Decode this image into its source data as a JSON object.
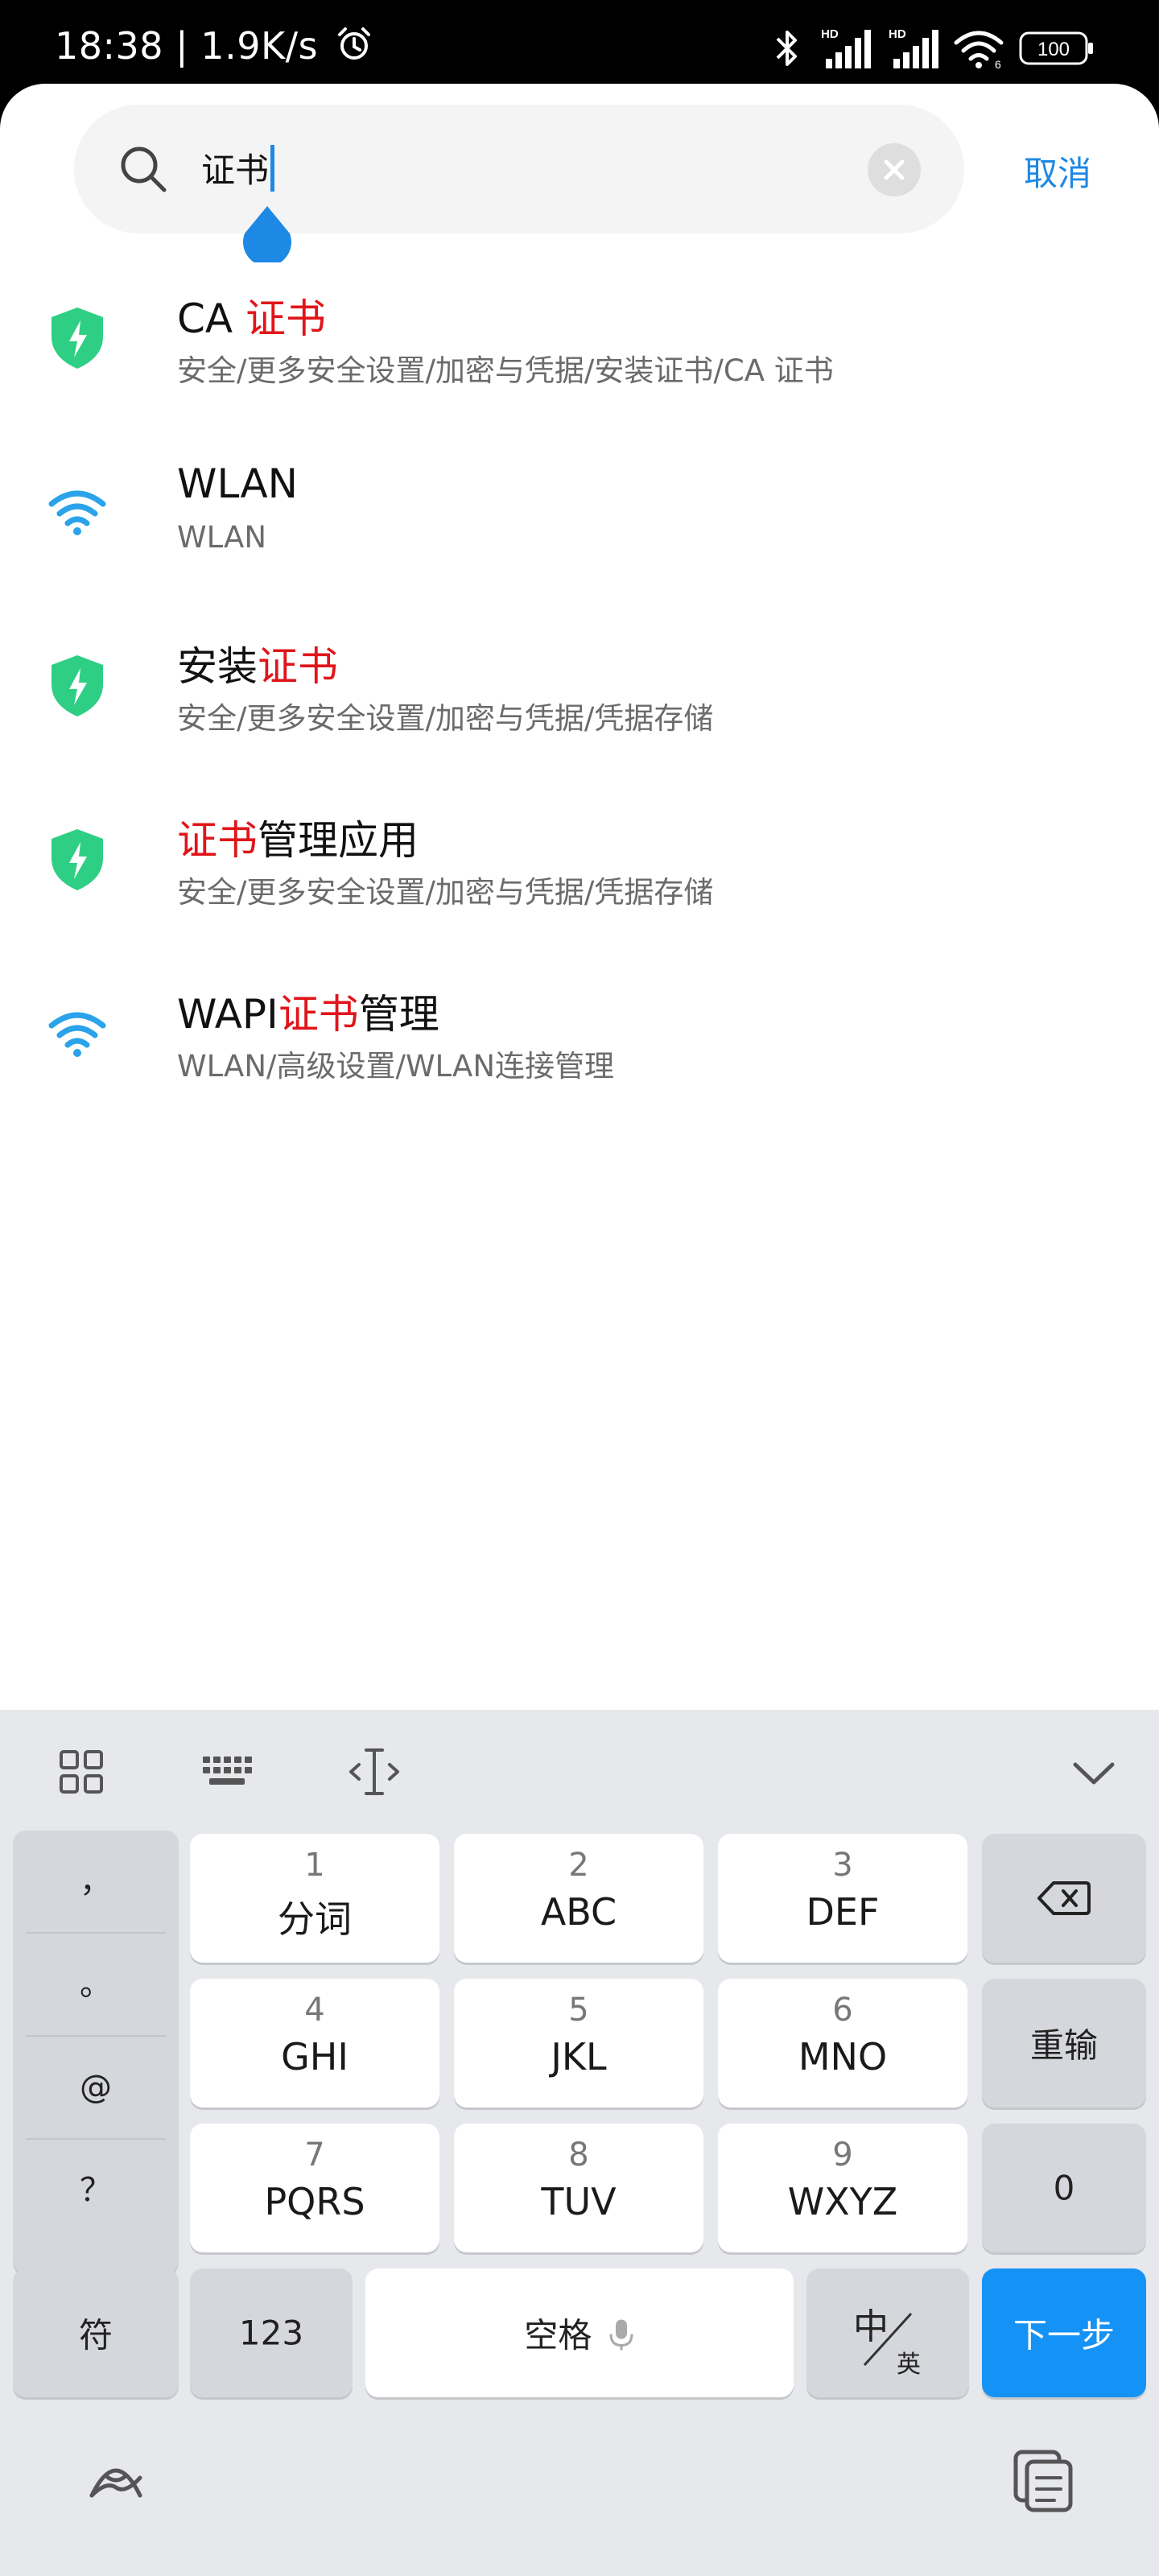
{
  "status_bar": {
    "time": "18:38 | 1.9K/s",
    "alarm_icon": "alarm-clock-icon",
    "bluetooth_icon": "bluetooth-icon",
    "signal1_label": "HD",
    "signal2_label": "HD",
    "wifi_label": "6",
    "battery": "100"
  },
  "search": {
    "query": "证书",
    "clear_icon": "clear-icon",
    "search_icon": "search-icon",
    "cancel_label": "取消"
  },
  "results": [
    {
      "icon": "shield-icon",
      "icon_color": "#2ecf85",
      "title_before": "CA ",
      "title_match": "证书",
      "title_after": "",
      "path": "安全/更多安全设置/加密与凭据/安装证书/CA 证书"
    },
    {
      "icon": "wifi-icon",
      "icon_color": "#2aa3ea",
      "title_before": "WLAN",
      "title_match": "",
      "title_after": "",
      "path": "WLAN"
    },
    {
      "icon": "shield-icon",
      "icon_color": "#2ecf85",
      "title_before": "安装",
      "title_match": "证书",
      "title_after": "",
      "path": "安全/更多安全设置/加密与凭据/凭据存储"
    },
    {
      "icon": "shield-icon",
      "icon_color": "#2ecf85",
      "title_before": "",
      "title_match": "证书",
      "title_after": "管理应用",
      "path": "安全/更多安全设置/加密与凭据/凭据存储"
    },
    {
      "icon": "wifi-icon",
      "icon_color": "#2aa3ea",
      "title_before": "WAPI",
      "title_match": "证书",
      "title_after": "管理",
      "path": "WLAN/高级设置/WLAN连接管理"
    }
  ],
  "highlight_color": "#e0151a",
  "keyboard": {
    "toolbar_icons": [
      "grid-icon",
      "keyboard-icon",
      "cursor-icon",
      "chevron-down-icon"
    ],
    "symbols": [
      "，",
      "。",
      "@",
      "？"
    ],
    "keys": [
      {
        "num": "1",
        "label": "分词"
      },
      {
        "num": "2",
        "label": "ABC"
      },
      {
        "num": "3",
        "label": "DEF"
      },
      {
        "num": "4",
        "label": "GHI"
      },
      {
        "num": "5",
        "label": "JKL"
      },
      {
        "num": "6",
        "label": "MNO"
      },
      {
        "num": "7",
        "label": "PQRS"
      },
      {
        "num": "8",
        "label": "TUV"
      },
      {
        "num": "9",
        "label": "WXYZ"
      }
    ],
    "backspace_icon": "backspace-icon",
    "reenter_label": "重输",
    "zero_label": "0",
    "symbol_label": "符",
    "num_label": "123",
    "space_label": "空格",
    "mic_icon": "mic-icon",
    "lang_top": "中",
    "lang_bottom": "英",
    "next_label": "下一步",
    "accent": "#1592f5",
    "bottom_left_icon": "ime-logo-icon",
    "bottom_right_icon": "clipboard-icon"
  }
}
